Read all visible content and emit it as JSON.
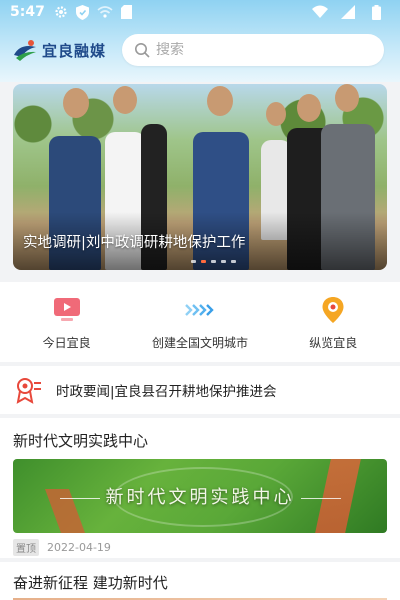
{
  "status_bar": {
    "time": "5:47"
  },
  "header": {
    "logo_text": "宜良融媒",
    "search_placeholder": "搜索"
  },
  "banner": {
    "title": "实地调研|刘中政调研耕地保护工作",
    "page_count": 5,
    "active_index": 1
  },
  "quick_nav": [
    {
      "label": "今日宜良",
      "icon": "tv-play-icon",
      "color": "#f06a78"
    },
    {
      "label": "创建全国文明城市",
      "icon": "chevrons-right-icon",
      "color": "#5ab6f0"
    },
    {
      "label": "纵览宜良",
      "icon": "location-pin-icon",
      "color": "#f5a623"
    }
  ],
  "ticker": {
    "text": "时政要闻|宜良县召开耕地保护推进会",
    "icon": "award-ribbon-icon",
    "color": "#e8483b"
  },
  "section1": {
    "title": "新时代文明实践中心",
    "image_text": "新时代文明实践中心",
    "tag": "置顶",
    "date": "2022-04-19"
  },
  "section2": {
    "title": "奋进新征程 建功新时代"
  }
}
